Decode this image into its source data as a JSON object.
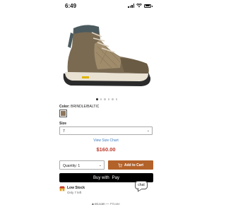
{
  "status_bar": {
    "time": "6:49"
  },
  "product": {
    "image_alt": "hiking boot",
    "color_label_prefix": "Color:",
    "color_value": "BRINDLE/BALTIC",
    "swatch_color": "#8c7559",
    "carousel": {
      "total": 6,
      "active_index": 0
    }
  },
  "size": {
    "label": "Size",
    "selected": "7",
    "size_chart_link": "View Size Chart"
  },
  "price": "$160.00",
  "quantity": {
    "label": "Quantity: 1"
  },
  "actions": {
    "add_to_cart": "Add to Cart",
    "apple_pay_prefix": "Buy with",
    "apple_pay_suffix": "Pay"
  },
  "stock": {
    "title": "Low Stock",
    "subtitle": "Only 7 left"
  },
  "chat": {
    "label": "chat"
  },
  "browser": {
    "url": "rei.com",
    "mode": "Private"
  },
  "colors": {
    "price": "#c0392b",
    "add_to_cart": "#b3622a",
    "link": "#3b7bbf"
  }
}
